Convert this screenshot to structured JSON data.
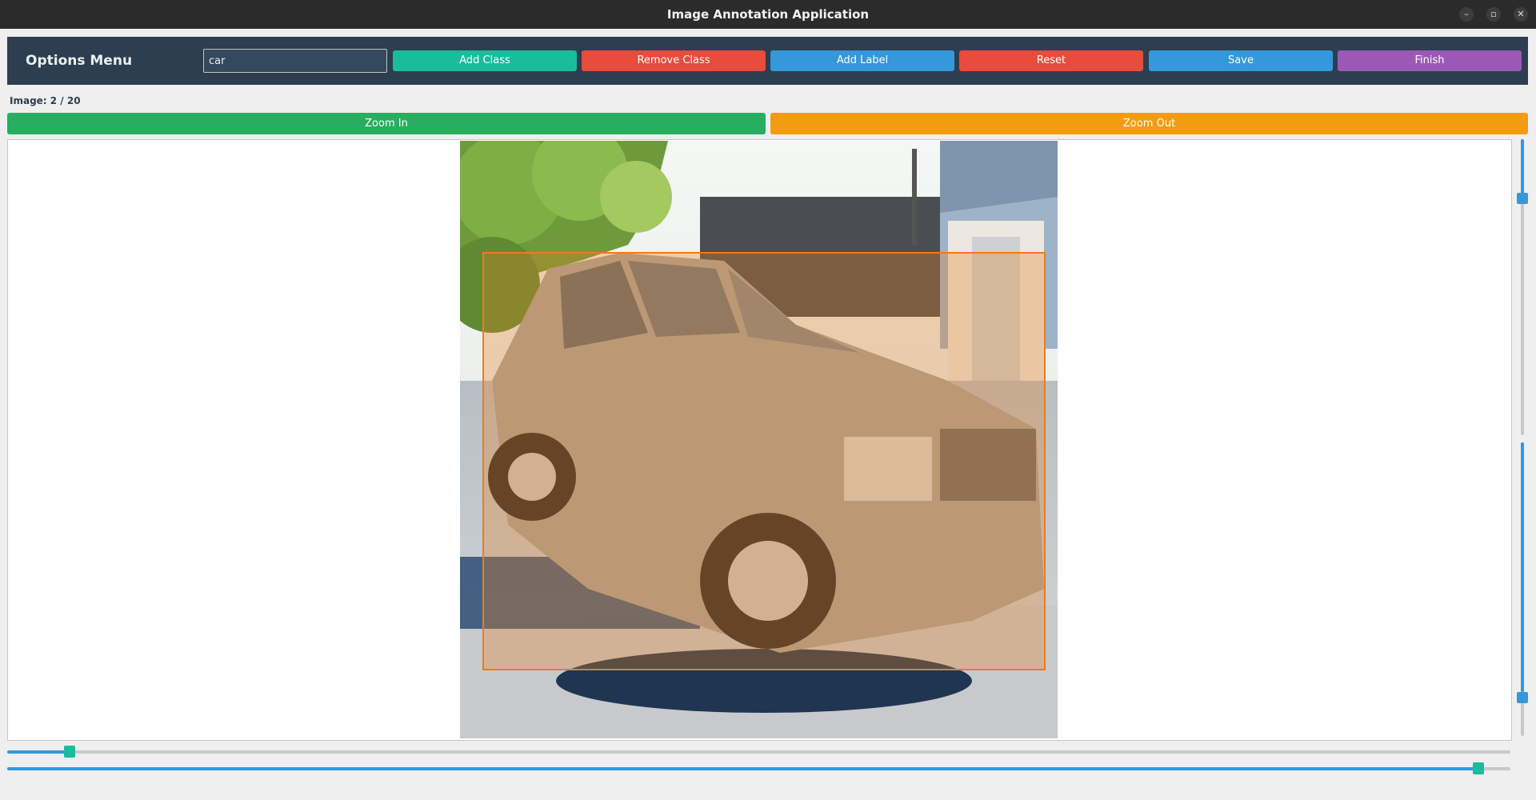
{
  "window": {
    "title": "Image Annotation Application"
  },
  "window_controls": {
    "minimize": "–",
    "maximize": "▫",
    "close": "✕"
  },
  "toolbar": {
    "menu_title": "Options Menu",
    "class_input_value": "car",
    "buttons": {
      "add_class": "Add Class",
      "remove_class": "Remove Class",
      "add_label": "Add Label",
      "reset": "Reset",
      "save": "Save",
      "finish": "Finish"
    }
  },
  "image_info": {
    "label": "Image: 2 / 20",
    "current": 2,
    "total": 20
  },
  "zoom": {
    "zoom_in": "Zoom In",
    "zoom_out": "Zoom Out"
  },
  "annotation": {
    "class": "car",
    "color": "#e67e22"
  },
  "sliders": {
    "vertical_top_value": 0.2,
    "vertical_bottom_value": 0.85,
    "horizontal_top_value": 0.04,
    "horizontal_bottom_value": 0.98
  },
  "colors": {
    "add_class": "#1abc9c",
    "remove_class": "#e74c3c",
    "add_label": "#3498db",
    "reset": "#e74c3c",
    "save": "#3498db",
    "finish": "#9b59b6",
    "zoom_in": "#27ae60",
    "zoom_out": "#f39c12",
    "toolbar_bg": "#2c3e50"
  }
}
